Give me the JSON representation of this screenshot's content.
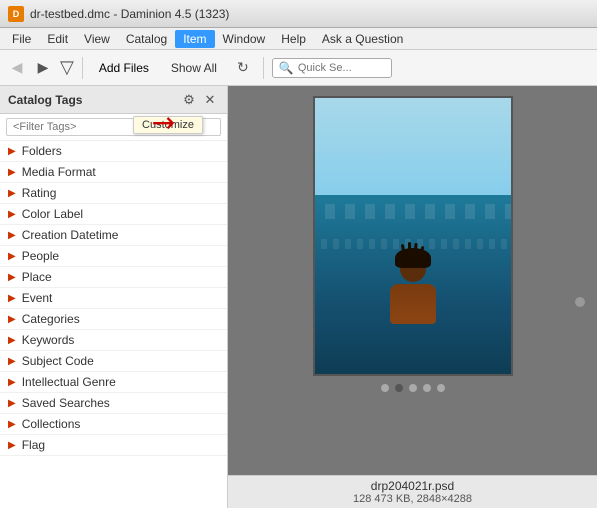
{
  "titlebar": {
    "icon": "D",
    "text": "dr-testbed.dmc - Daminion 4.5 (1323)"
  },
  "menubar": {
    "items": [
      "File",
      "Edit",
      "View",
      "Catalog",
      "Item",
      "Window",
      "Help",
      "Ask a Question"
    ]
  },
  "toolbar": {
    "back_label": "◄",
    "forward_label": "►",
    "add_files_label": "Add Files",
    "show_all_label": "Show All",
    "refresh_label": "↻",
    "search_placeholder": "Quick Se...",
    "nav_down": "▽"
  },
  "left_panel": {
    "title": "Catalog Tags",
    "filter_placeholder": "<Filter Tags>",
    "customize_tooltip": "Customize",
    "tags": [
      {
        "label": "Folders"
      },
      {
        "label": "Media Format"
      },
      {
        "label": "Rating"
      },
      {
        "label": "Color Label"
      },
      {
        "label": "Creation Datetime"
      },
      {
        "label": "People"
      },
      {
        "label": "Place"
      },
      {
        "label": "Event"
      },
      {
        "label": "Categories"
      },
      {
        "label": "Keywords"
      },
      {
        "label": "Subject Code"
      },
      {
        "label": "Intellectual Genre"
      },
      {
        "label": "Saved Searches"
      },
      {
        "label": "Collections"
      },
      {
        "label": "Flag"
      }
    ]
  },
  "preview": {
    "filename": "drp204021r.psd",
    "fileinfo": "128 473 KB, 2848×4288",
    "dots": [
      1,
      2,
      3,
      4,
      5
    ],
    "active_dot": 2
  }
}
